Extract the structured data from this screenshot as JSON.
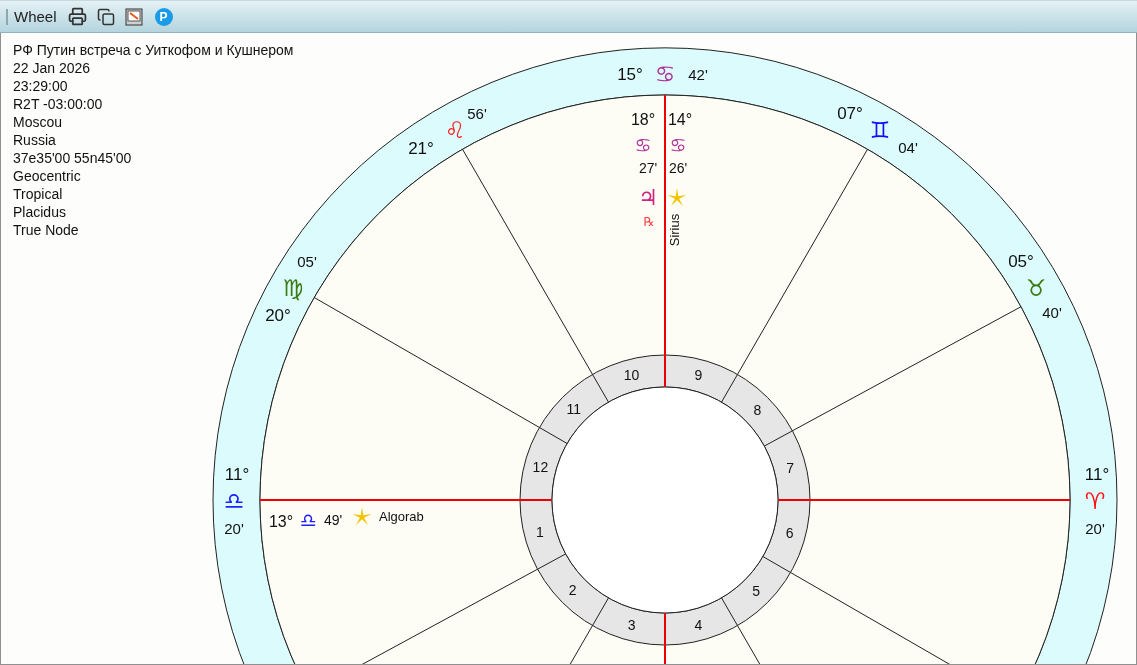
{
  "toolbar": {
    "title": "Wheel",
    "badge": "P"
  },
  "chart_info": [
    "РФ Путин встреча с Уиткофом и Кушнером",
    "22 Jan 2026",
    "23:29:00",
    "R2T -03:00:00",
    "Moscou",
    "Russia",
    "37e35'00 55n45'00",
    "Geocentric",
    "Tropical",
    "Placidus",
    "True Node"
  ],
  "cusps": [
    {
      "degree": "15°",
      "sign": "♋",
      "minutes": "42'",
      "color": "#b0309a"
    },
    {
      "degree": "21°",
      "sign": "♌",
      "minutes": "56'",
      "color": "#ff2020"
    },
    {
      "degree": "07°",
      "sign": "♊",
      "minutes": "04'",
      "color": "#1010ff"
    },
    {
      "degree": "20°",
      "sign": "♍",
      "minutes": "05'",
      "color": "#3a7a10"
    },
    {
      "degree": "05°",
      "sign": "♉",
      "minutes": "40'",
      "color": "#3a7a10"
    },
    {
      "degree": "11°",
      "sign": "♎",
      "minutes": "20'",
      "color": "#2020ff"
    },
    {
      "degree": "11°",
      "sign": "♈",
      "minutes": "20'",
      "color": "#ff1010"
    }
  ],
  "bodies": [
    {
      "kind": "planet",
      "degree": "18°",
      "sign": "♋",
      "minutes": "27'",
      "glyph": "♃",
      "retrograde_mark": "℞",
      "color": "#b0309a"
    },
    {
      "kind": "star",
      "degree": "14°",
      "sign": "♋",
      "minutes": "26'",
      "name": "Sirius",
      "color": "#b0309a"
    },
    {
      "kind": "star",
      "degree": "13°",
      "sign": "♎",
      "minutes": "49'",
      "name": "Algorab",
      "color": "#2020ff"
    }
  ],
  "houses": [
    "1",
    "2",
    "3",
    "4",
    "5",
    "6",
    "7",
    "8",
    "9",
    "10",
    "11",
    "12"
  ]
}
